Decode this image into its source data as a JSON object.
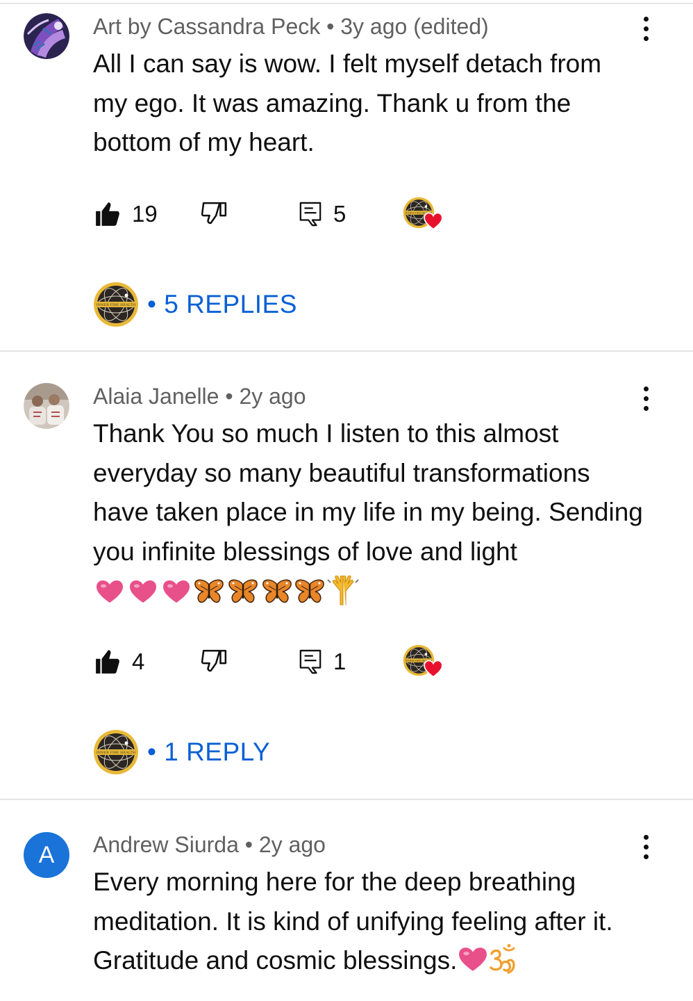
{
  "comments": [
    {
      "author": "Art by Cassandra Peck",
      "time": "3y ago (edited)",
      "text": "All I can say is wow. I felt myself detach from\nmy ego. It was amazing. Thank u from the\nbottom of my heart.",
      "likes": "19",
      "reply_count": "5",
      "replies_label": "5 REPLIES",
      "avatar_icon": "purple-artwork-avatar"
    },
    {
      "author": "Alaia Janelle",
      "time": "2y ago",
      "text": "Thank You so much I listen to this almost\neveryday so many beautiful transformations\nhave taken place in my life in my being. Sending\nyou  infinite blessings of love and light",
      "emojis": [
        "pink-heart",
        "pink-heart",
        "pink-heart",
        "butterfly",
        "butterfly",
        "butterfly",
        "butterfly",
        "raising-hands"
      ],
      "likes": "4",
      "reply_count": "1",
      "replies_label": "1 REPLY",
      "avatar_icon": "photo-avatar"
    },
    {
      "author": "Andrew Siurda",
      "time": "2y ago",
      "text": "Every morning here for the deep breathing\nmeditation. It is kind of unifying feeling after it.\nGratitude and cosmic blessings.",
      "trailing_emojis": [
        "pink-heart",
        "om"
      ],
      "avatar_letter": "A",
      "avatar_color": "#1a73d9"
    }
  ],
  "separator": " • ",
  "colors": {
    "link": "#065fd4",
    "meta": "#606060",
    "heart": "#e8112d",
    "pink_heart": "#e8508a",
    "channel_gold": "#e8b938"
  }
}
